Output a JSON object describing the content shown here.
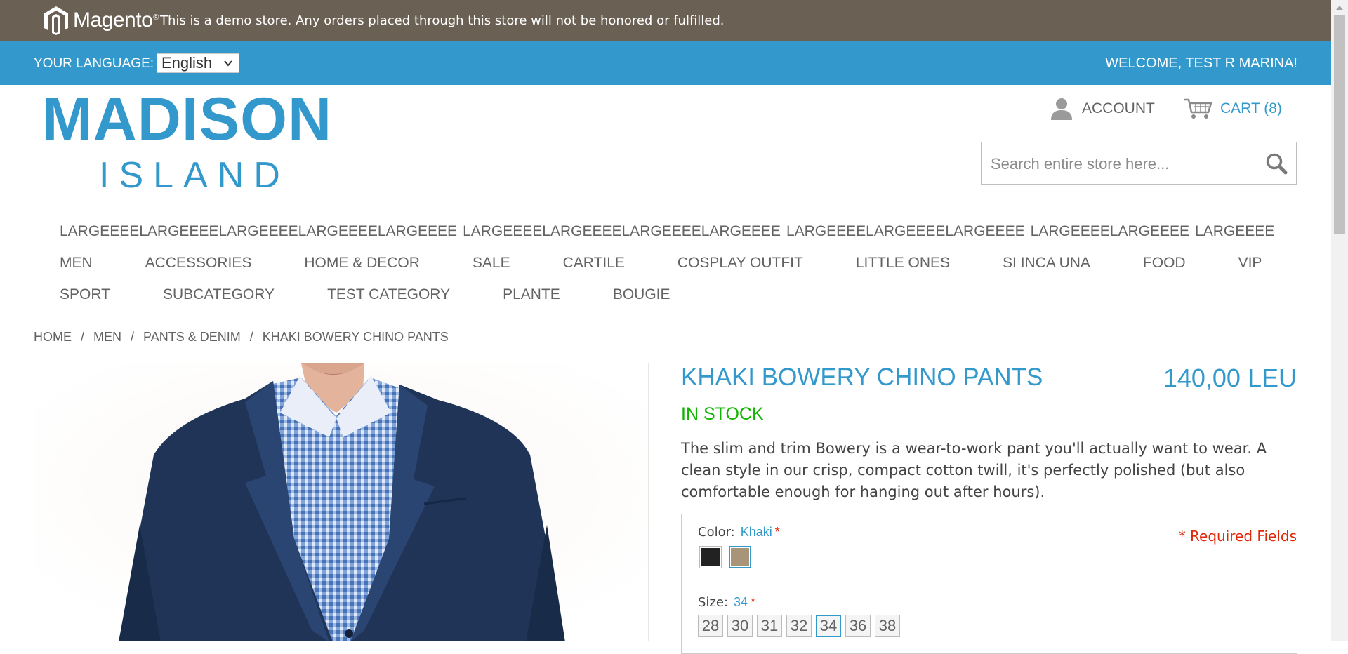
{
  "demo_notice": {
    "logo_text": "Magento",
    "text": "This is a demo store. Any orders placed through this store will not be honored or fulfilled."
  },
  "language_bar": {
    "label": "YOUR LANGUAGE:",
    "selected_language": "English",
    "welcome": "WELCOME, TEST R MARINA!"
  },
  "header": {
    "logo_line1": "MADISON",
    "logo_line2": "ISLAND",
    "account_label": "ACCOUNT",
    "account_icon": "user-icon",
    "cart_label": "CART (8)",
    "cart_icon": "cart-icon",
    "search_placeholder": "Search entire store here...",
    "search_icon": "search-icon"
  },
  "nav": {
    "row1": [
      "LARGEEEELARGEEEELARGEEEELARGEEEELARGEEEE",
      "LARGEEEELARGEEEELARGEEEELARGEEEE",
      "LARGEEEELARGEEEELARGEEEE",
      "LARGEEEELARGEEEE",
      "LARGEEEE"
    ],
    "row2": [
      "MEN",
      "ACCESSORIES",
      "HOME & DECOR",
      "SALE",
      "CARTILE",
      "COSPLAY OUTFIT",
      "LITTLE ONES",
      "SI INCA UNA",
      "FOOD",
      "VIP"
    ],
    "row3": [
      "SPORT",
      "SUBCATEGORY",
      "TEST CATEGORY",
      "PLANTE",
      "BOUGIE"
    ]
  },
  "breadcrumb": [
    "HOME",
    "MEN",
    "PANTS & DENIM",
    "KHAKI BOWERY CHINO PANTS"
  ],
  "breadcrumb_separator": "/",
  "product": {
    "name": "KHAKI BOWERY CHINO PANTS",
    "price": "140,00 LEU",
    "stock": "IN STOCK",
    "description": "The slim and trim Bowery is a wear-to-work pant you'll actually want to wear. A clean style in our crisp, compact cotton twill, it's perfectly polished (but also comfortable enough for hanging out after hours).",
    "options": {
      "required_note": "* Required Fields",
      "color_label": "Color:",
      "color_value": "Khaki",
      "required_star": "*",
      "colors": [
        {
          "name": "Black",
          "hex": "#222222"
        },
        {
          "name": "Khaki",
          "hex": "#a79479"
        }
      ],
      "selected_color": "Khaki",
      "size_label": "Size:",
      "size_value": "34",
      "sizes": [
        "28",
        "30",
        "31",
        "32",
        "34",
        "36",
        "38"
      ],
      "selected_size": "34"
    }
  },
  "colors": {
    "demo_bar": "#6b6054",
    "accent": "#3399cc",
    "in_stock": "#11b400",
    "required": "#df280a"
  }
}
